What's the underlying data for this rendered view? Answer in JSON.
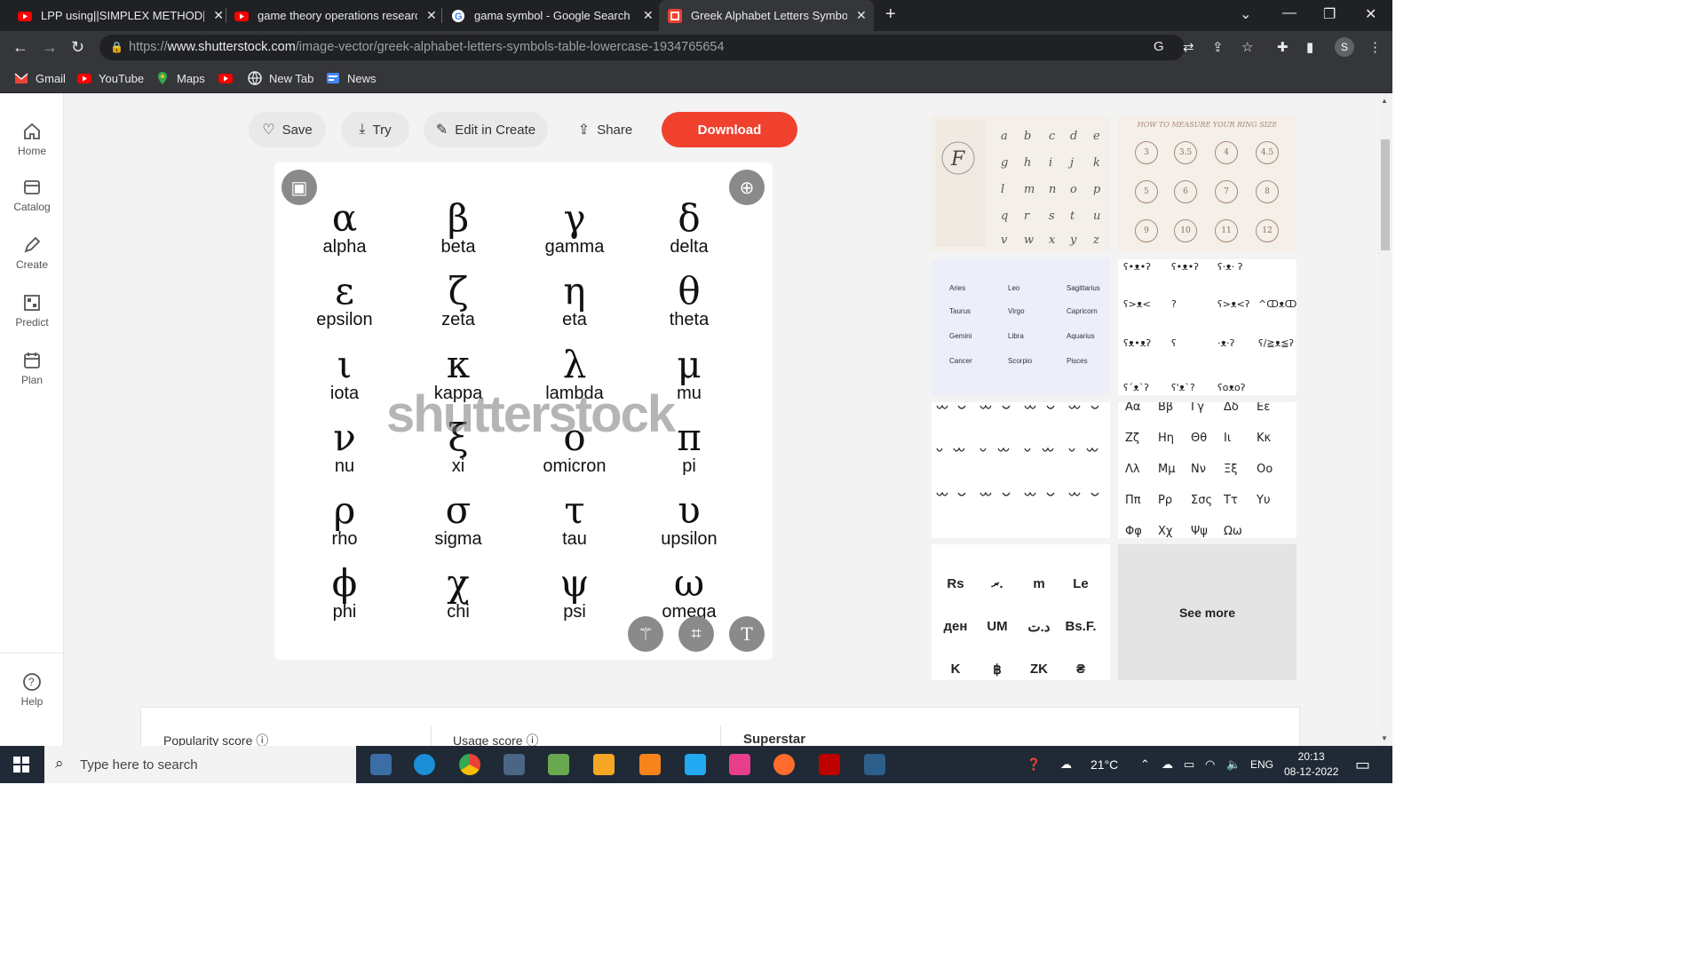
{
  "tabs": [
    {
      "title": "LPP using||SIMPLEX METHOD||si",
      "color": "#ff0000"
    },
    {
      "title": "game theory operations research",
      "color": "#ff0000"
    },
    {
      "title": "gama symbol - Google Search",
      "color": "#4285f4"
    },
    {
      "title": "Greek Alphabet Letters Symbols T",
      "color": "#f0402e"
    }
  ],
  "address": {
    "protocol": "https://",
    "host": "www.shutterstock.com",
    "path": "/image-vector/greek-alphabet-letters-symbols-table-lowercase-1934765654"
  },
  "bookmarks": [
    {
      "label": "Gmail",
      "icon": "gmail-icon"
    },
    {
      "label": "YouTube",
      "icon": "youtube-icon"
    },
    {
      "label": "Maps",
      "icon": "maps-icon"
    },
    {
      "label": "",
      "icon": "youtube-icon"
    },
    {
      "label": "New Tab",
      "icon": "globe-icon"
    },
    {
      "label": "News",
      "icon": "news-icon"
    }
  ],
  "leftnav": [
    {
      "label": "Home",
      "icon": "home-icon"
    },
    {
      "label": "Catalog",
      "icon": "catalog-icon"
    },
    {
      "label": "Create",
      "icon": "create-icon"
    },
    {
      "label": "Predict",
      "icon": "predict-icon"
    },
    {
      "label": "Plan",
      "icon": "plan-icon"
    }
  ],
  "help": {
    "label": "Help"
  },
  "actions": {
    "save": "Save",
    "try": "Try",
    "edit": "Edit in Create",
    "share": "Share",
    "download": "Download"
  },
  "greek": [
    {
      "g": "α",
      "n": "alpha"
    },
    {
      "g": "β",
      "n": "beta"
    },
    {
      "g": "γ",
      "n": "gamma"
    },
    {
      "g": "δ",
      "n": "delta"
    },
    {
      "g": "ε",
      "n": "epsilon"
    },
    {
      "g": "ζ",
      "n": "zeta"
    },
    {
      "g": "η",
      "n": "eta"
    },
    {
      "g": "θ",
      "n": "theta"
    },
    {
      "g": "ι",
      "n": "iota"
    },
    {
      "g": "κ",
      "n": "kappa"
    },
    {
      "g": "λ",
      "n": "lambda"
    },
    {
      "g": "μ",
      "n": "mu"
    },
    {
      "g": "ν",
      "n": "nu"
    },
    {
      "g": "ξ",
      "n": "xi"
    },
    {
      "g": "ο",
      "n": "omicron"
    },
    {
      "g": "π",
      "n": "pi"
    },
    {
      "g": "ρ",
      "n": "rho"
    },
    {
      "g": "σ",
      "n": "sigma"
    },
    {
      "g": "τ",
      "n": "tau"
    },
    {
      "g": "υ",
      "n": "upsilon"
    },
    {
      "g": "ϕ",
      "n": "phi"
    },
    {
      "g": "χ",
      "n": "chi"
    },
    {
      "g": "ψ",
      "n": "psi"
    },
    {
      "g": "ω",
      "n": "omega"
    }
  ],
  "watermark": "shutterstock",
  "thumbs": {
    "ring_title": "HOW TO MEASURE YOUR RING SIZE",
    "ring_sizes": [
      "3",
      "3.5",
      "4",
      "4.5",
      "5",
      "6",
      "7",
      "8",
      "9",
      "10",
      "11",
      "12"
    ],
    "zodiac": [
      "Aries",
      "Leo",
      "Sagittarius",
      "Taurus",
      "Virgo",
      "Capricorn",
      "Gemini",
      "Libra",
      "Aquarius",
      "Cancer",
      "Scorpio",
      "Pisces"
    ],
    "kaomoji": [
      "ʕ•ᴥ•ʔ",
      "ʕ•ᴥ•ʔ",
      "ʕ·ᴥ· ʔ",
      "ʕ>ᴥ<",
      "?",
      "ʕ>ᴥ<ʔ",
      "^ↀᴥↀ^",
      "ʕᴥ•ᴥʔ",
      "ʕ",
      "·ᴥ·ʔ",
      "ʕ/≧ᴥ≦ʔ",
      "ʕ´ᴥ`ʔ",
      "ʕ'ᴥ`?",
      "ʕoᴥoʔ"
    ],
    "greek_pairs": [
      "Αα",
      "Ββ",
      "Γγ",
      "Δδ",
      "Εε",
      "Ζζ",
      "Ηη",
      "Θθ",
      "Ιι",
      "Κκ",
      "Λλ",
      "Μμ",
      "Νν",
      "Ξξ",
      "Οο",
      "Ππ",
      "Ρρ",
      "Σσς",
      "Ττ",
      "Υυ",
      "Φφ",
      "Χχ",
      "Ψψ",
      "Ωω"
    ],
    "currency": [
      "Rs",
      "ރ.",
      "m",
      "Le",
      "ден",
      "UM",
      "د.ت",
      "Bs.F.",
      "K",
      "฿",
      "ZK",
      "₴"
    ]
  },
  "see_more": "See more",
  "scores": {
    "popularity": "Popularity score",
    "usage": "Usage score",
    "superstar": "Superstar"
  },
  "taskbar": {
    "search_placeholder": "Type here to search",
    "temp": "21°C",
    "lang": "ENG",
    "time": "20:13",
    "date": "08-12-2022"
  }
}
